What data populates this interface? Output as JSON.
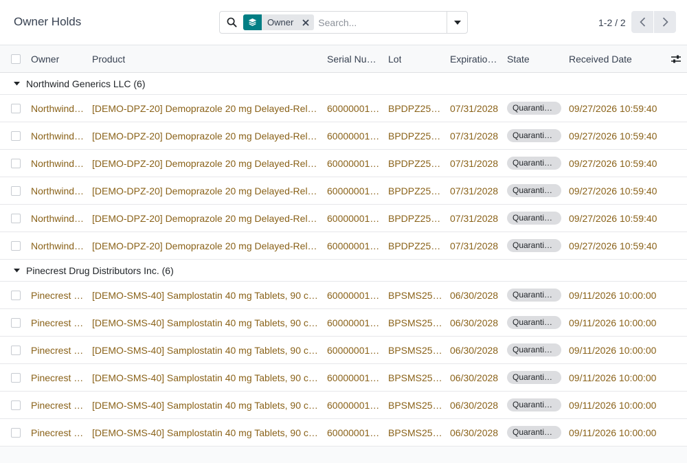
{
  "header": {
    "title": "Owner Holds",
    "search": {
      "facet_label": "Owner",
      "placeholder": "Search..."
    },
    "pager": {
      "value": "1-2 / 2"
    }
  },
  "table": {
    "columns": {
      "owner": "Owner",
      "product": "Product",
      "serial": "Serial Nu…",
      "lot": "Lot",
      "expiration": "Expiratio…",
      "state": "State",
      "received": "Received Date"
    },
    "groups": [
      {
        "label": "Northwind Generics LLC (6)",
        "rows": [
          {
            "owner": "Northwind…",
            "product": "[DEMO-DPZ-20] Demoprazole 20 mg Delayed-Rel…",
            "serial": "60000001…",
            "lot": "BPDPZ25…",
            "expiration": "07/31/2028",
            "state": "Quaranti…",
            "received": "09/27/2026 10:59:40"
          },
          {
            "owner": "Northwind…",
            "product": "[DEMO-DPZ-20] Demoprazole 20 mg Delayed-Rel…",
            "serial": "60000001…",
            "lot": "BPDPZ25…",
            "expiration": "07/31/2028",
            "state": "Quaranti…",
            "received": "09/27/2026 10:59:40"
          },
          {
            "owner": "Northwind…",
            "product": "[DEMO-DPZ-20] Demoprazole 20 mg Delayed-Rel…",
            "serial": "60000001…",
            "lot": "BPDPZ25…",
            "expiration": "07/31/2028",
            "state": "Quaranti…",
            "received": "09/27/2026 10:59:40"
          },
          {
            "owner": "Northwind…",
            "product": "[DEMO-DPZ-20] Demoprazole 20 mg Delayed-Rel…",
            "serial": "60000001…",
            "lot": "BPDPZ25…",
            "expiration": "07/31/2028",
            "state": "Quaranti…",
            "received": "09/27/2026 10:59:40"
          },
          {
            "owner": "Northwind…",
            "product": "[DEMO-DPZ-20] Demoprazole 20 mg Delayed-Rel…",
            "serial": "60000001…",
            "lot": "BPDPZ25…",
            "expiration": "07/31/2028",
            "state": "Quaranti…",
            "received": "09/27/2026 10:59:40"
          },
          {
            "owner": "Northwind…",
            "product": "[DEMO-DPZ-20] Demoprazole 20 mg Delayed-Rel…",
            "serial": "60000001…",
            "lot": "BPDPZ25…",
            "expiration": "07/31/2028",
            "state": "Quaranti…",
            "received": "09/27/2026 10:59:40"
          }
        ]
      },
      {
        "label": "Pinecrest Drug Distributors Inc. (6)",
        "rows": [
          {
            "owner": "Pinecrest …",
            "product": "[DEMO-SMS-40] Samplostatin 40 mg Tablets, 90 c…",
            "serial": "60000001…",
            "lot": "BPSMS25…",
            "expiration": "06/30/2028",
            "state": "Quaranti…",
            "received": "09/11/2026 10:00:00"
          },
          {
            "owner": "Pinecrest …",
            "product": "[DEMO-SMS-40] Samplostatin 40 mg Tablets, 90 c…",
            "serial": "60000001…",
            "lot": "BPSMS25…",
            "expiration": "06/30/2028",
            "state": "Quaranti…",
            "received": "09/11/2026 10:00:00"
          },
          {
            "owner": "Pinecrest …",
            "product": "[DEMO-SMS-40] Samplostatin 40 mg Tablets, 90 c…",
            "serial": "60000001…",
            "lot": "BPSMS25…",
            "expiration": "06/30/2028",
            "state": "Quaranti…",
            "received": "09/11/2026 10:00:00"
          },
          {
            "owner": "Pinecrest …",
            "product": "[DEMO-SMS-40] Samplostatin 40 mg Tablets, 90 c…",
            "serial": "60000001…",
            "lot": "BPSMS25…",
            "expiration": "06/30/2028",
            "state": "Quaranti…",
            "received": "09/11/2026 10:00:00"
          },
          {
            "owner": "Pinecrest …",
            "product": "[DEMO-SMS-40] Samplostatin 40 mg Tablets, 90 c…",
            "serial": "60000001…",
            "lot": "BPSMS25…",
            "expiration": "06/30/2028",
            "state": "Quaranti…",
            "received": "09/11/2026 10:00:00"
          },
          {
            "owner": "Pinecrest …",
            "product": "[DEMO-SMS-40] Samplostatin 40 mg Tablets, 90 c…",
            "serial": "60000001…",
            "lot": "BPSMS25…",
            "expiration": "06/30/2028",
            "state": "Quaranti…",
            "received": "09/11/2026 10:00:00"
          }
        ]
      }
    ]
  },
  "colors": {
    "accent": "#017e84",
    "link_text": "#8a6219",
    "badge_bg": "#dcdde0"
  }
}
